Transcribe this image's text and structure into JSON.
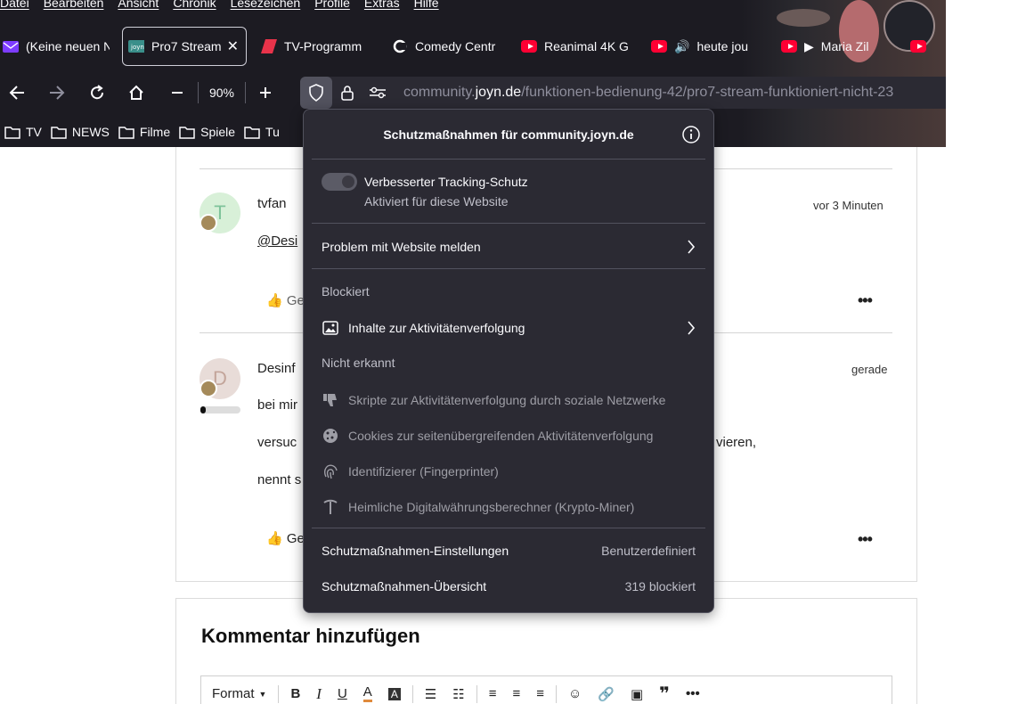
{
  "menubar": [
    "Datei",
    "Bearbeiten",
    "Ansicht",
    "Chronik",
    "Lesezeichen",
    "Profile",
    "Extras",
    "Hilfe"
  ],
  "tabs": [
    {
      "label": "(Keine neuen N"
    },
    {
      "label": "Pro7 Stream"
    },
    {
      "label": "TV-Programm"
    },
    {
      "label": "Comedy Centr"
    },
    {
      "label": "Reanimal 4K G"
    },
    {
      "label": "heute jou"
    },
    {
      "label": "Maria Zil"
    }
  ],
  "toolbar": {
    "zoom": "90%"
  },
  "url": {
    "prefix": "community.",
    "host": "joyn.de",
    "path": "/funktionen-bedienung-42/pro7-stream-funktioniert-nicht-23"
  },
  "bookmarks": [
    "TV",
    "NEWS",
    "Filme",
    "Spiele",
    "Tu"
  ],
  "posts": [
    {
      "avatar_letter": "T",
      "author": "tvfan",
      "time": "vor 3 Minuten",
      "body": "@Desi",
      "like_label": "Ge"
    },
    {
      "avatar_letter": "D",
      "author": "Desinf",
      "time": "gerade",
      "lines": [
        "bei mir",
        "versuc",
        "nennt s"
      ],
      "tail": "vieren,",
      "like_label": "Ge"
    }
  ],
  "comment": {
    "title": "Kommentar hinzufügen",
    "format_label": "Format"
  },
  "popup": {
    "title": "Schutzmaßnahmen für community.joyn.de",
    "tracking_title": "Verbesserter Tracking-Schutz",
    "tracking_sub": "Aktiviert für diese Website",
    "report": "Problem mit Website melden",
    "blocked_heading": "Blockiert",
    "blocked_items": [
      "Inhalte zur Aktivitätenverfolgung"
    ],
    "not_detected_heading": "Nicht erkannt",
    "not_detected_items": [
      "Skripte zur Aktivitätenverfolgung durch soziale Netzwerke",
      "Cookies zur seitenübergreifenden Aktivitätenverfolgung",
      "Identifizierer (Fingerprinter)",
      "Heimliche Digitalwährungsberechner (Krypto-Miner)"
    ],
    "settings_label": "Schutzmaßnahmen-Einstellungen",
    "settings_value": "Benutzerdefiniert",
    "overview_label": "Schutzmaßnahmen-Übersicht",
    "overview_value": "319 blockiert"
  }
}
